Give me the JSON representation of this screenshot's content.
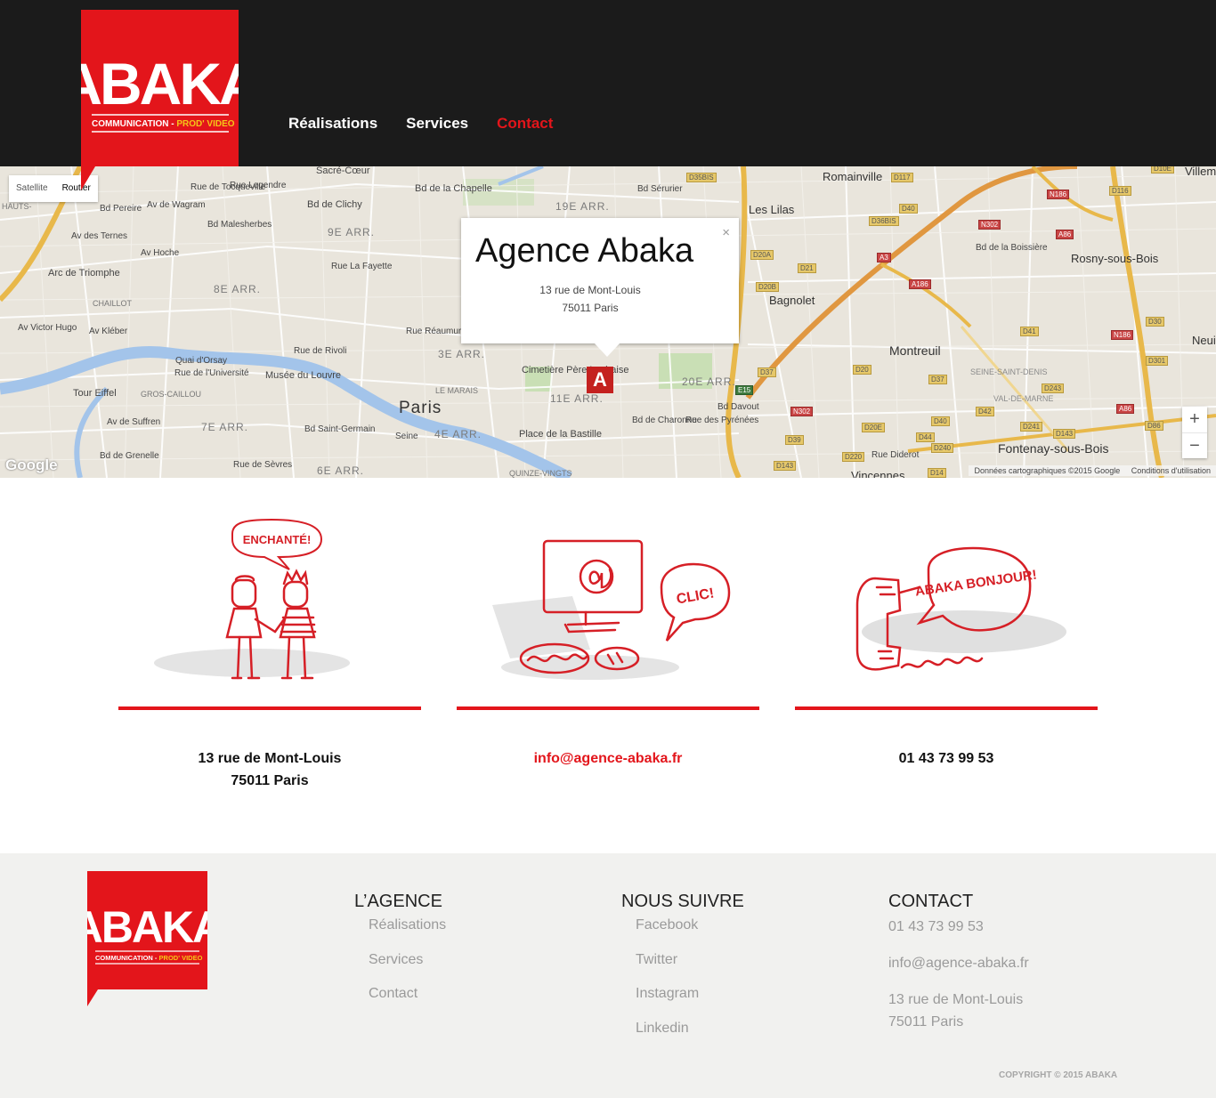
{
  "brand": {
    "name": "ABAKA",
    "tagline_part1": "COMMUNICATION - ",
    "tagline_part2": "PROD' VIDEO",
    "primary_color": "#e3151b",
    "accent_color": "#f5c518"
  },
  "nav": {
    "items": [
      {
        "label": "Réalisations",
        "active": false
      },
      {
        "label": "Services",
        "active": false
      },
      {
        "label": "Contact",
        "active": true
      }
    ]
  },
  "map": {
    "type_buttons": [
      "Satellite",
      "Routier"
    ],
    "selected_type": "Routier",
    "infowindow": {
      "title": "Agence Abaka",
      "address_line1": "13 rue de Mont-Louis",
      "address_line2": "75011 Paris",
      "close_icon": "×"
    },
    "marker_letter": "A",
    "zoom_in": "+",
    "zoom_out": "−",
    "google_logo": "Google",
    "attribution": "Données cartographiques ©2015 Google",
    "terms": "Conditions d'utilisation",
    "labels": {
      "sacre_coeur": "Sacré-Cœur",
      "bd_chapelle": "Bd de la Chapelle",
      "bd_clichy": "Bd de Clichy",
      "arr_19": "19E ARR.",
      "arr_9": "9E ARR.",
      "arr_8": "8E ARR.",
      "arr_3": "3E ARR.",
      "arr_4": "4E ARR.",
      "arr_7": "7E ARR.",
      "arr_6": "6E ARR.",
      "arr_11": "11E ARR.",
      "arr_20": "20E ARR.",
      "arc": "Arc de Triomphe",
      "chaillot": "CHAILLOT",
      "quai_orsay": "Quai d'Orsay",
      "rue_universite": "Rue de l'Université",
      "musee_louvre": "Musée du Louvre",
      "tour_eiffel": "Tour Eiffel",
      "gros_caillou": "GROS-CAILLOU",
      "paris": "Paris",
      "le_marais": "LE MARAIS",
      "rue_rivoli": "Rue de Rivoli",
      "rue_reaumur": "Rue Réaumur",
      "rue_lafayette": "Rue La Fayette",
      "bastille": "Place de la Bastille",
      "cimetiere": "Cimetière Père Lachaise",
      "bd_st_germain": "Bd Saint-Germain",
      "seine": "Seine",
      "av_suffren": "Av de Suffren",
      "bd_grenelle": "Bd de Grenelle",
      "rue_sevres": "Rue de Sèvres",
      "av_victor_hugo": "Av Victor Hugo",
      "av_kleber": "Av Kléber",
      "av_hoche": "Av Hoche",
      "av_ternes": "Av des Ternes",
      "bd_pereire": "Bd Pereire",
      "av_wagram": "Av de Wagram",
      "bd_malesherbes": "Bd Malesherbes",
      "rue_legendre": "Rue Legendre",
      "rue_tocqueville": "Rue de Tocqueville",
      "bd_davout": "Bd Davout",
      "bd_charonne": "Bd de Charonne",
      "rue_pyrenees": "Rue des Pyrénées",
      "bd_serurier": "Bd Sérurier",
      "quinze_vingts": "QUINZE-VINGTS",
      "romainville": "Romainville",
      "les_lilas": "Les Lilas",
      "bagnolet": "Bagnolet",
      "montreuil": "Montreuil",
      "rosny": "Rosny-sous-Bois",
      "fontenay": "Fontenay-sous-Bois",
      "villemomble": "Villem",
      "neuilly": "Neuil",
      "vincennes": "Vincennes",
      "seine_st_denis": "SEINE-SAINT-DENIS",
      "val_de_marne": "VAL-DE-MARNE",
      "bd_boissiere": "Bd de la Boissière",
      "rue_diderot": "Rue Diderot",
      "hauts": "HAUTS-"
    },
    "roads": [
      "D35BIS",
      "D117",
      "D40",
      "D36BIS",
      "D20A",
      "D21",
      "D20B",
      "D37",
      "E15",
      "D116",
      "N186",
      "N302",
      "A86",
      "A3",
      "A186",
      "D41",
      "D30",
      "N186",
      "D301",
      "D20",
      "D37",
      "D42",
      "D243",
      "A86",
      "D86",
      "N302",
      "D20E",
      "D44",
      "D40",
      "D241",
      "D143",
      "D39",
      "D220",
      "D240",
      "D143",
      "D14",
      "D10E",
      "D37"
    ]
  },
  "contact_blocks": [
    {
      "lines": [
        "13 rue de Mont-Louis",
        "75011 Paris"
      ],
      "bubble": "ENCHANTÉ!"
    },
    {
      "lines": [
        "info@agence-abaka.fr"
      ],
      "bubble": "CLIC!"
    },
    {
      "lines": [
        "01 43 73 99 53"
      ],
      "bubble": "ABAKA BONJOUR!"
    }
  ],
  "footer": {
    "agence": {
      "heading": "L’AGENCE",
      "links": [
        "Réalisations",
        "Services",
        "Contact"
      ]
    },
    "suivre": {
      "heading": "NOUS SUIVRE",
      "links": [
        "Facebook",
        "Twitter",
        "Instagram",
        "Linkedin"
      ]
    },
    "contact": {
      "heading": "CONTACT",
      "phone": "01 43 73 99 53",
      "email": "info@agence-abaka.fr",
      "address_line1": "13 rue de Mont-Louis",
      "address_line2": "75011 Paris"
    },
    "copyright": "COPYRIGHT © 2015 ABAKA"
  }
}
